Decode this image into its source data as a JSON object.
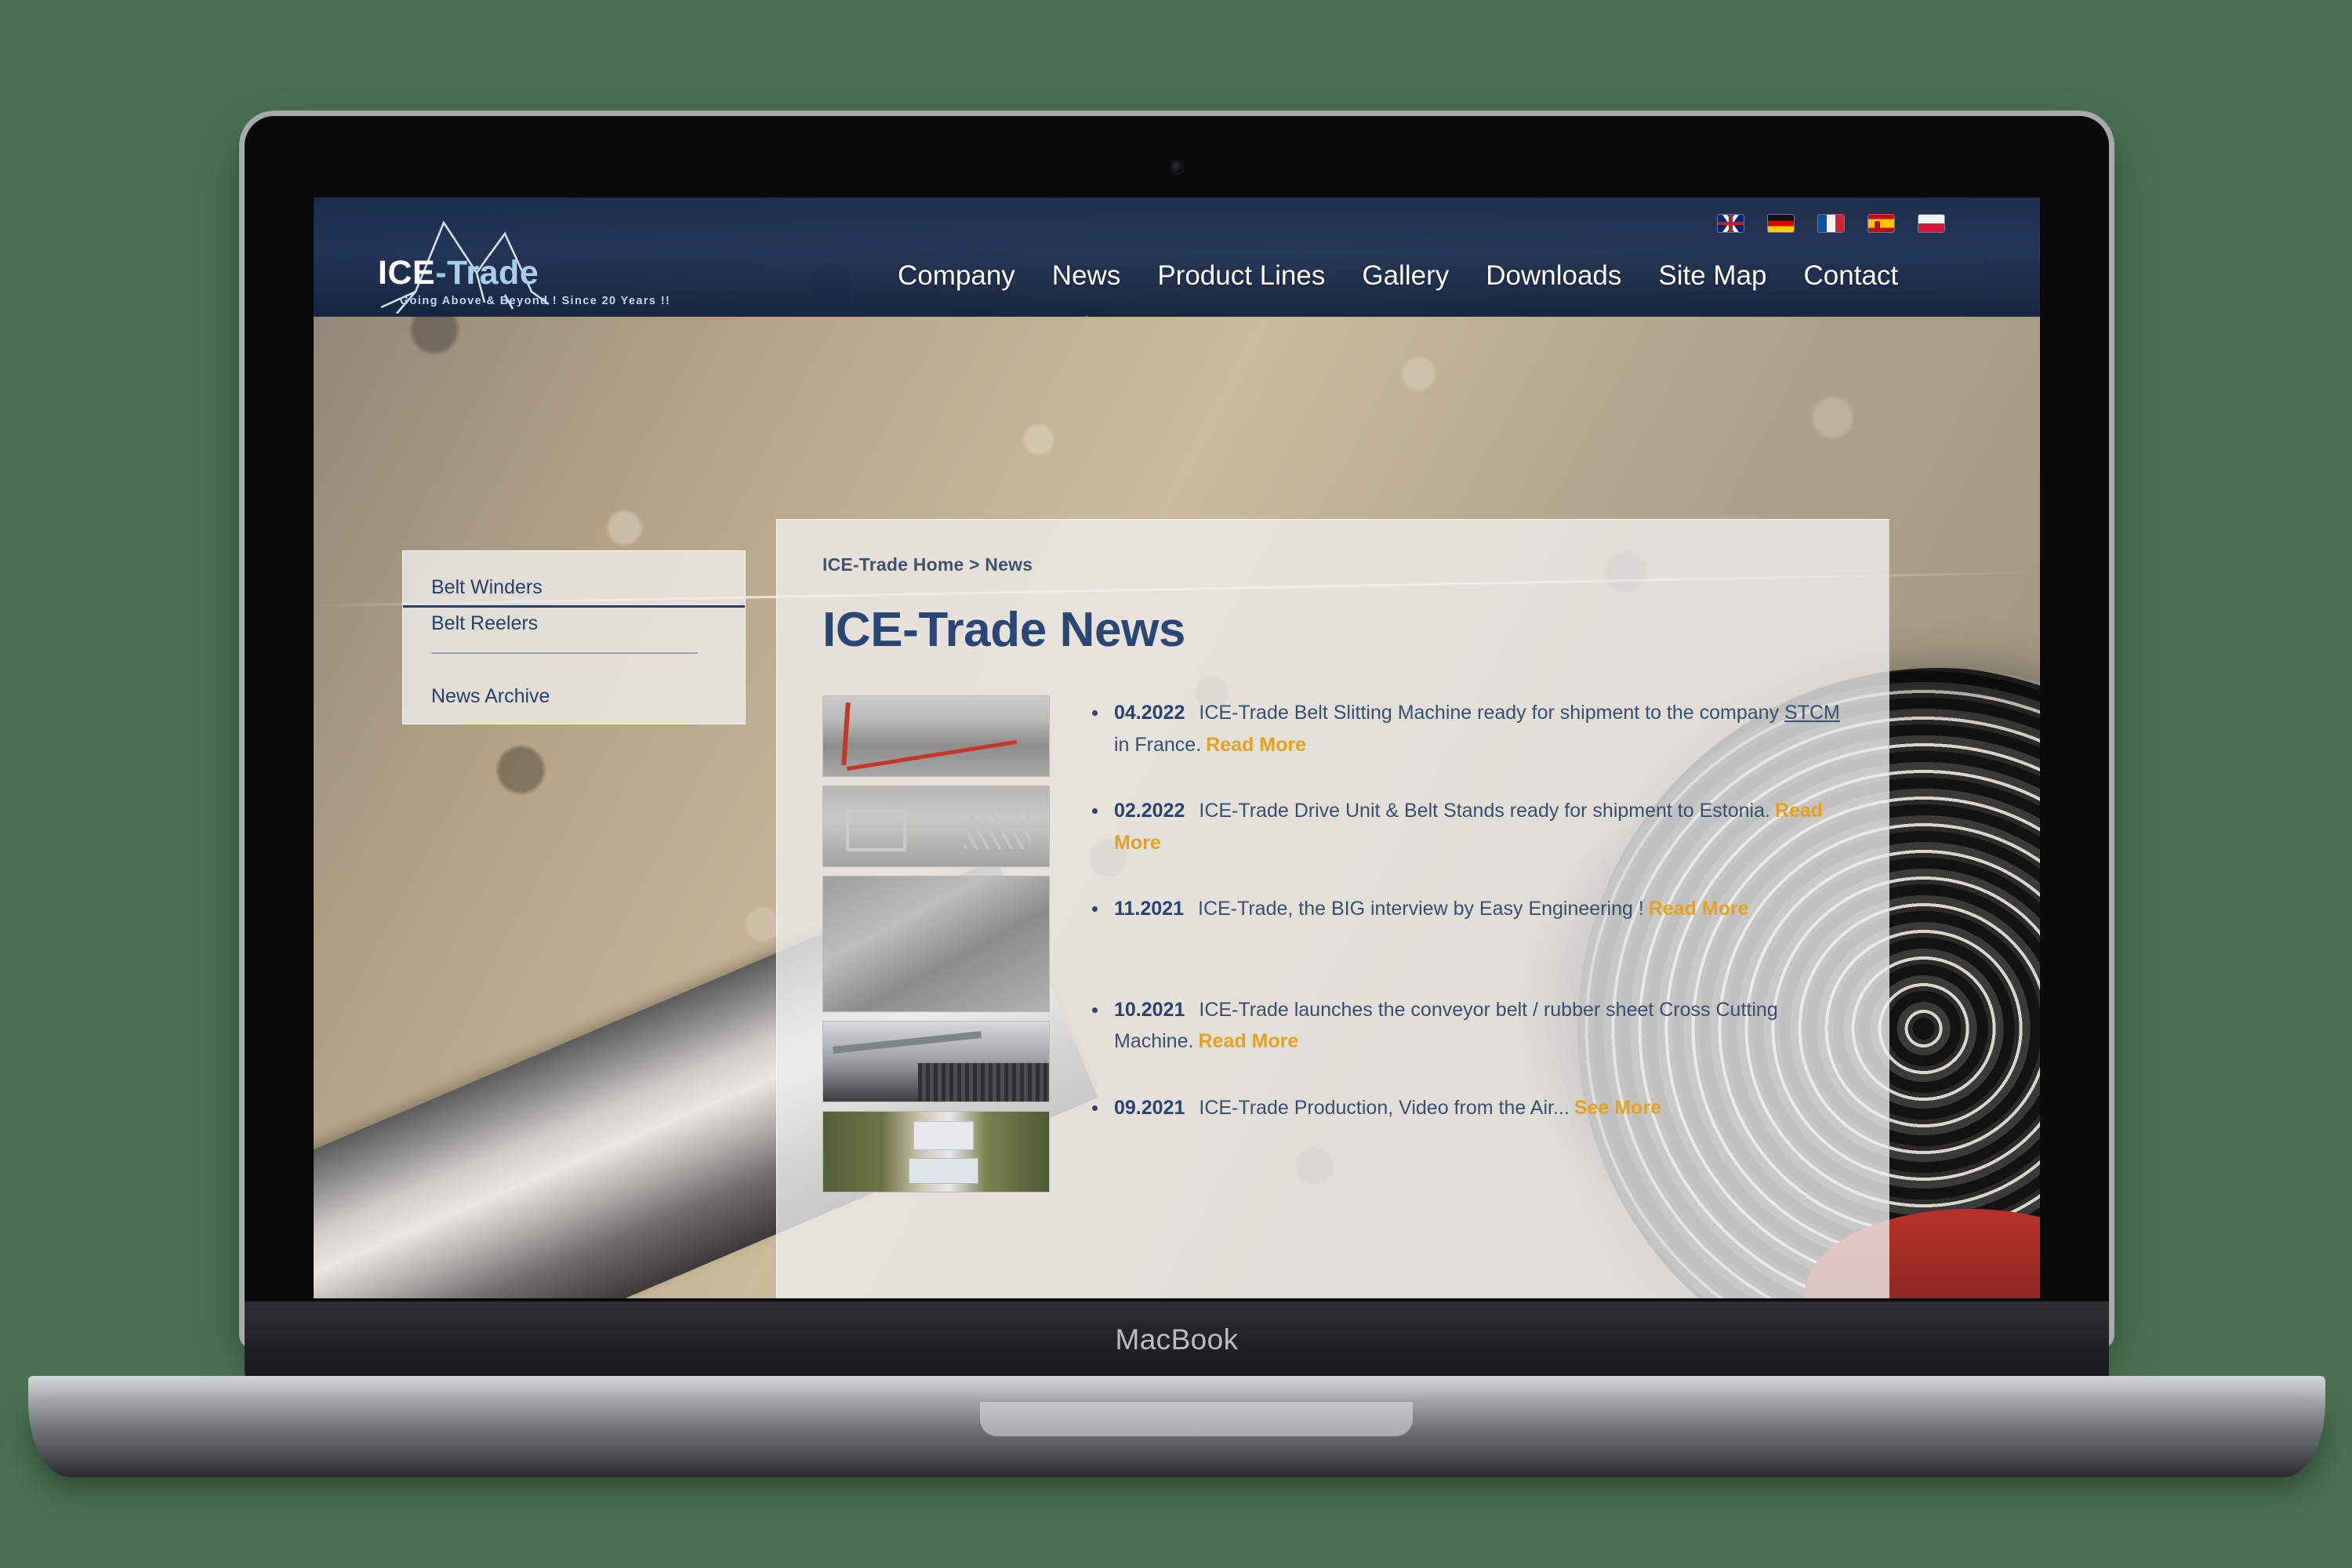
{
  "device": {
    "brand_label": "MacBook",
    "camera_icon": "webcam-icon"
  },
  "site": {
    "logo": {
      "name_ice": "ICE",
      "name_dash": "-",
      "name_trade": "Trade",
      "tagline": "Going Above & Beyond ! Since 20 Years !!"
    },
    "language_flags": [
      {
        "code": "uk",
        "label": "English"
      },
      {
        "code": "de",
        "label": "Deutsch"
      },
      {
        "code": "fr",
        "label": "Français"
      },
      {
        "code": "es",
        "label": "Español"
      },
      {
        "code": "pl",
        "label": "Polski"
      }
    ],
    "nav": [
      {
        "label": "Company",
        "active": false
      },
      {
        "label": "News",
        "active": true
      },
      {
        "label": "Product Lines",
        "active": false
      },
      {
        "label": "Gallery",
        "active": false
      },
      {
        "label": "Downloads",
        "active": false
      },
      {
        "label": "Site Map",
        "active": false
      },
      {
        "label": "Contact",
        "active": false
      }
    ],
    "sidebar": {
      "items": [
        {
          "label": "Belt Winders"
        },
        {
          "label": "Belt Reelers"
        },
        {
          "label": "News Archive"
        }
      ]
    },
    "main": {
      "breadcrumb": "ICE-Trade Home > News",
      "page_title": "ICE-Trade News",
      "thumbnails": [
        {
          "name": "belt-slitting-machine-thumb"
        },
        {
          "name": "drive-unit-belt-stands-thumb"
        },
        {
          "name": "rubber-sheet-thumb"
        },
        {
          "name": "cross-cutting-machine-thumb"
        },
        {
          "name": "aerial-production-thumb"
        }
      ],
      "news_items": [
        {
          "date": "04.2022",
          "text_before": "ICE-Trade Belt Slitting Machine ready for shipment to the company ",
          "text_underlined": "STCM",
          "text_after": " in France.",
          "link_label": "Read More"
        },
        {
          "date": "02.2022",
          "text_before": "ICE-Trade Drive Unit & Belt Stands ready for shipment to Estonia.",
          "text_underlined": "",
          "text_after": "",
          "link_label": "Read More"
        },
        {
          "date": "11.2021",
          "text_before": "ICE-Trade, the BIG interview by Easy Engineering !",
          "text_underlined": "",
          "text_after": "",
          "link_label": "Read More"
        },
        {
          "date": "10.2021",
          "text_before": "ICE-Trade launches the conveyor belt / rubber sheet Cross Cutting Machine.",
          "text_underlined": "",
          "text_after": "",
          "link_label": "Read More"
        },
        {
          "date": "09.2021",
          "text_before": "ICE-Trade Production, Video from the Air...",
          "text_underlined": "",
          "text_after": "",
          "link_label": "See More"
        }
      ]
    },
    "colors": {
      "header_blue": "#152a4a",
      "title_blue": "#2b4674",
      "body_blue": "#3b4d6c",
      "link_orange": "#e8a020",
      "page_background_green": "#4a7151",
      "panel_background": "#eeeeec"
    }
  }
}
